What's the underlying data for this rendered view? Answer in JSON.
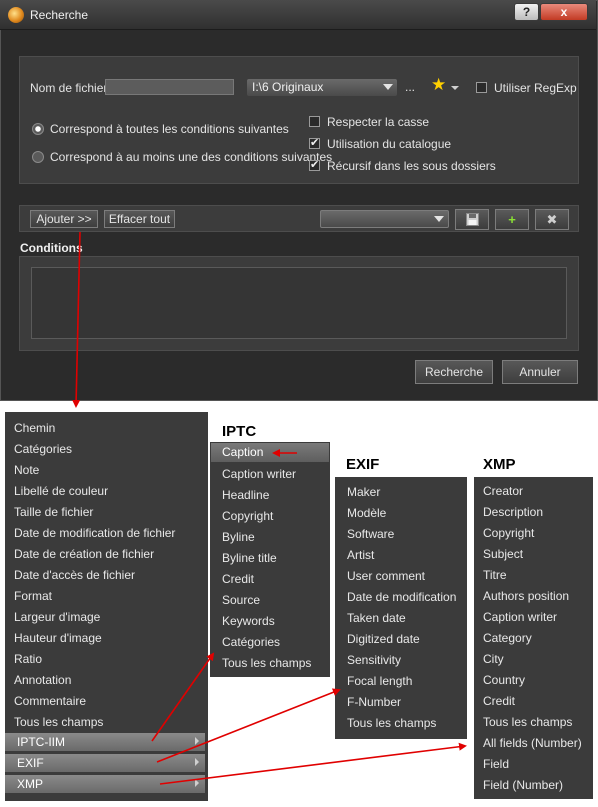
{
  "window": {
    "title": "Recherche",
    "help_label": "?",
    "close_label": "x"
  },
  "form": {
    "filename_label": "Nom de fichier",
    "filename_value": "",
    "path_value": "I:\\6 Originaux",
    "ellipsis_label": "...",
    "regexp_label": "Utiliser RegExp",
    "regexp_checked": false,
    "match_all_label": "Correspond à toutes les conditions suivantes",
    "match_any_label": "Correspond à au moins une des conditions suivantes",
    "case_label": "Respecter la casse",
    "case_checked": false,
    "catalog_label": "Utilisation du catalogue",
    "catalog_checked": true,
    "recursive_label": "Récursif dans les sous dossiers",
    "recursive_checked": true
  },
  "toolbar": {
    "add_label": "Ajouter >>",
    "clear_label": "Effacer tout",
    "preset_value": ""
  },
  "conditions": {
    "title": "Conditions"
  },
  "footer": {
    "search_label": "Recherche",
    "cancel_label": "Annuler"
  },
  "main_menu": {
    "items": [
      "Chemin",
      "Catégories",
      "Note",
      "Libellé de couleur",
      "Taille de fichier",
      "Date de modification de fichier",
      "Date de création de fichier",
      "Date d'accès de fichier",
      "Format",
      "Largeur d'image",
      "Hauteur d'image",
      "Ratio",
      "Annotation",
      "Commentaire",
      "Tous les champs"
    ],
    "submenus": [
      "IPTC-IIM",
      "EXIF",
      "XMP"
    ]
  },
  "iptc_menu": {
    "heading": "IPTC",
    "items": [
      "Caption",
      "Caption writer",
      "Headline",
      "Copyright",
      "Byline",
      "Byline title",
      "Credit",
      "Source",
      "Keywords",
      "Catégories",
      "Tous les champs"
    ]
  },
  "exif_menu": {
    "heading": "EXIF",
    "items": [
      "Maker",
      "Modèle",
      "Software",
      "Artist",
      "User comment",
      "Date de modification",
      "Taken date",
      "Digitized date",
      "Sensitivity",
      "Focal length",
      "F-Number",
      "Tous les champs"
    ]
  },
  "xmp_menu": {
    "heading": "XMP",
    "items": [
      "Creator",
      "Description",
      "Copyright",
      "Subject",
      "Titre",
      "Authors position",
      "Caption writer",
      "Category",
      "City",
      "Country",
      "Credit",
      "Tous les champs",
      "All fields (Number)",
      "Field",
      "Field (Number)"
    ]
  },
  "colors": {
    "window_bg": "#2b2b2b",
    "panel_bg": "#3c3c3c",
    "menu_bg": "#3b3b3b",
    "annotation_arrow": "#e00000",
    "star": "#ffd000"
  },
  "icons": {
    "favorites": "star-icon",
    "save": "save-icon",
    "add": "plus-icon",
    "delete": "close-icon"
  }
}
